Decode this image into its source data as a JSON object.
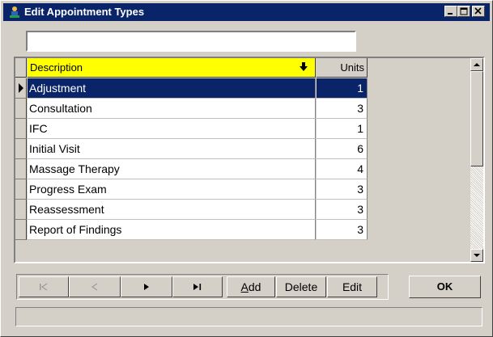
{
  "window": {
    "title": "Edit Appointment Types"
  },
  "search": {
    "value": "",
    "placeholder": ""
  },
  "grid": {
    "columns": {
      "description": "Description",
      "units": "Units"
    },
    "header_color": "#ffff00",
    "selection_color": "#0a246a",
    "rows": [
      {
        "description": "Adjustment",
        "units": "1"
      },
      {
        "description": "Consultation",
        "units": "3"
      },
      {
        "description": "IFC",
        "units": "1"
      },
      {
        "description": "Initial Visit",
        "units": "6"
      },
      {
        "description": "Massage Therapy",
        "units": "4"
      },
      {
        "description": "Progress Exam",
        "units": "3"
      },
      {
        "description": "Reassessment",
        "units": "3"
      },
      {
        "description": "Report of Findings",
        "units": "3"
      }
    ],
    "selected_index": 0
  },
  "navigator": {
    "first_icon": "first-record-icon",
    "prior_icon": "prior-record-icon",
    "next_icon": "next-record-icon",
    "last_icon": "last-record-icon",
    "add_prefix": "A",
    "add_rest": "dd",
    "delete_label": "Delete",
    "edit_label": "Edit"
  },
  "ok_label": "OK",
  "status_text": ""
}
